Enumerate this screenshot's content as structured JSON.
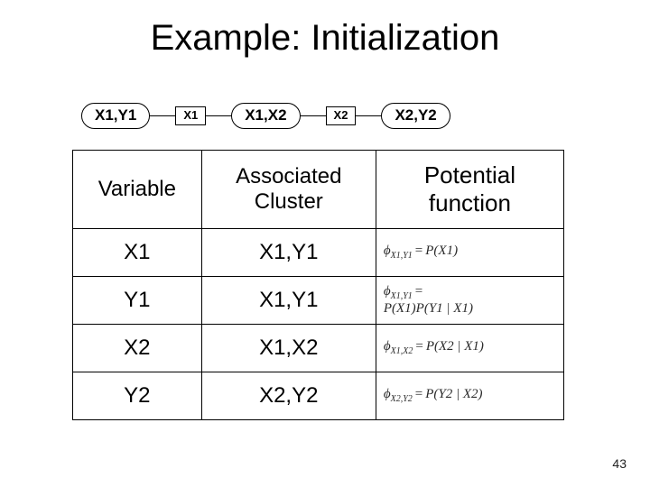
{
  "title": "Example: Initialization",
  "junction_tree": {
    "clusters": [
      "X1,Y1",
      "X1,X2",
      "X2,Y2"
    ],
    "separators": [
      "X1",
      "X2"
    ]
  },
  "table": {
    "headers": {
      "var": "Variable",
      "assoc": "Associated Cluster",
      "pot": "Potential function"
    },
    "rows": [
      {
        "var": "X1",
        "assoc": "X1,Y1",
        "potential_sym": "ϕ",
        "potential_sub": "X1,Y1",
        "rhs_lines": [
          "P(X1)"
        ]
      },
      {
        "var": "Y1",
        "assoc": "X1,Y1",
        "potential_sym": "ϕ",
        "potential_sub": "X1,Y1",
        "rhs_lines": [
          "",
          "P(X1)P(Y1 | X1)"
        ],
        "stacked_lhs": true
      },
      {
        "var": "X2",
        "assoc": "X1,X2",
        "potential_sym": "ϕ",
        "potential_sub": "X1,X2",
        "rhs_lines": [
          "P(X2 | X1)"
        ]
      },
      {
        "var": "Y2",
        "assoc": "X2,Y2",
        "potential_sym": "ϕ",
        "potential_sub": "X2,Y2",
        "rhs_lines": [
          "P(Y2 | X2)"
        ]
      }
    ]
  },
  "page_number": "43",
  "chart_data": {
    "type": "table",
    "title": "Example: Initialization",
    "columns": [
      "Variable",
      "Associated Cluster",
      "Potential function"
    ],
    "rows": [
      [
        "X1",
        "X1,Y1",
        "phi_{X1,Y1} = P(X1)"
      ],
      [
        "Y1",
        "X1,Y1",
        "phi_{X1,Y1} = P(X1) P(Y1 | X1)"
      ],
      [
        "X2",
        "X1,X2",
        "phi_{X1,X2} = P(X2 | X1)"
      ],
      [
        "Y2",
        "X2,Y2",
        "phi_{X2,Y2} = P(Y2 | X2)"
      ]
    ],
    "junction_tree_sequence": [
      "X1,Y1",
      "X1",
      "X1,X2",
      "X2",
      "X2,Y2"
    ]
  }
}
